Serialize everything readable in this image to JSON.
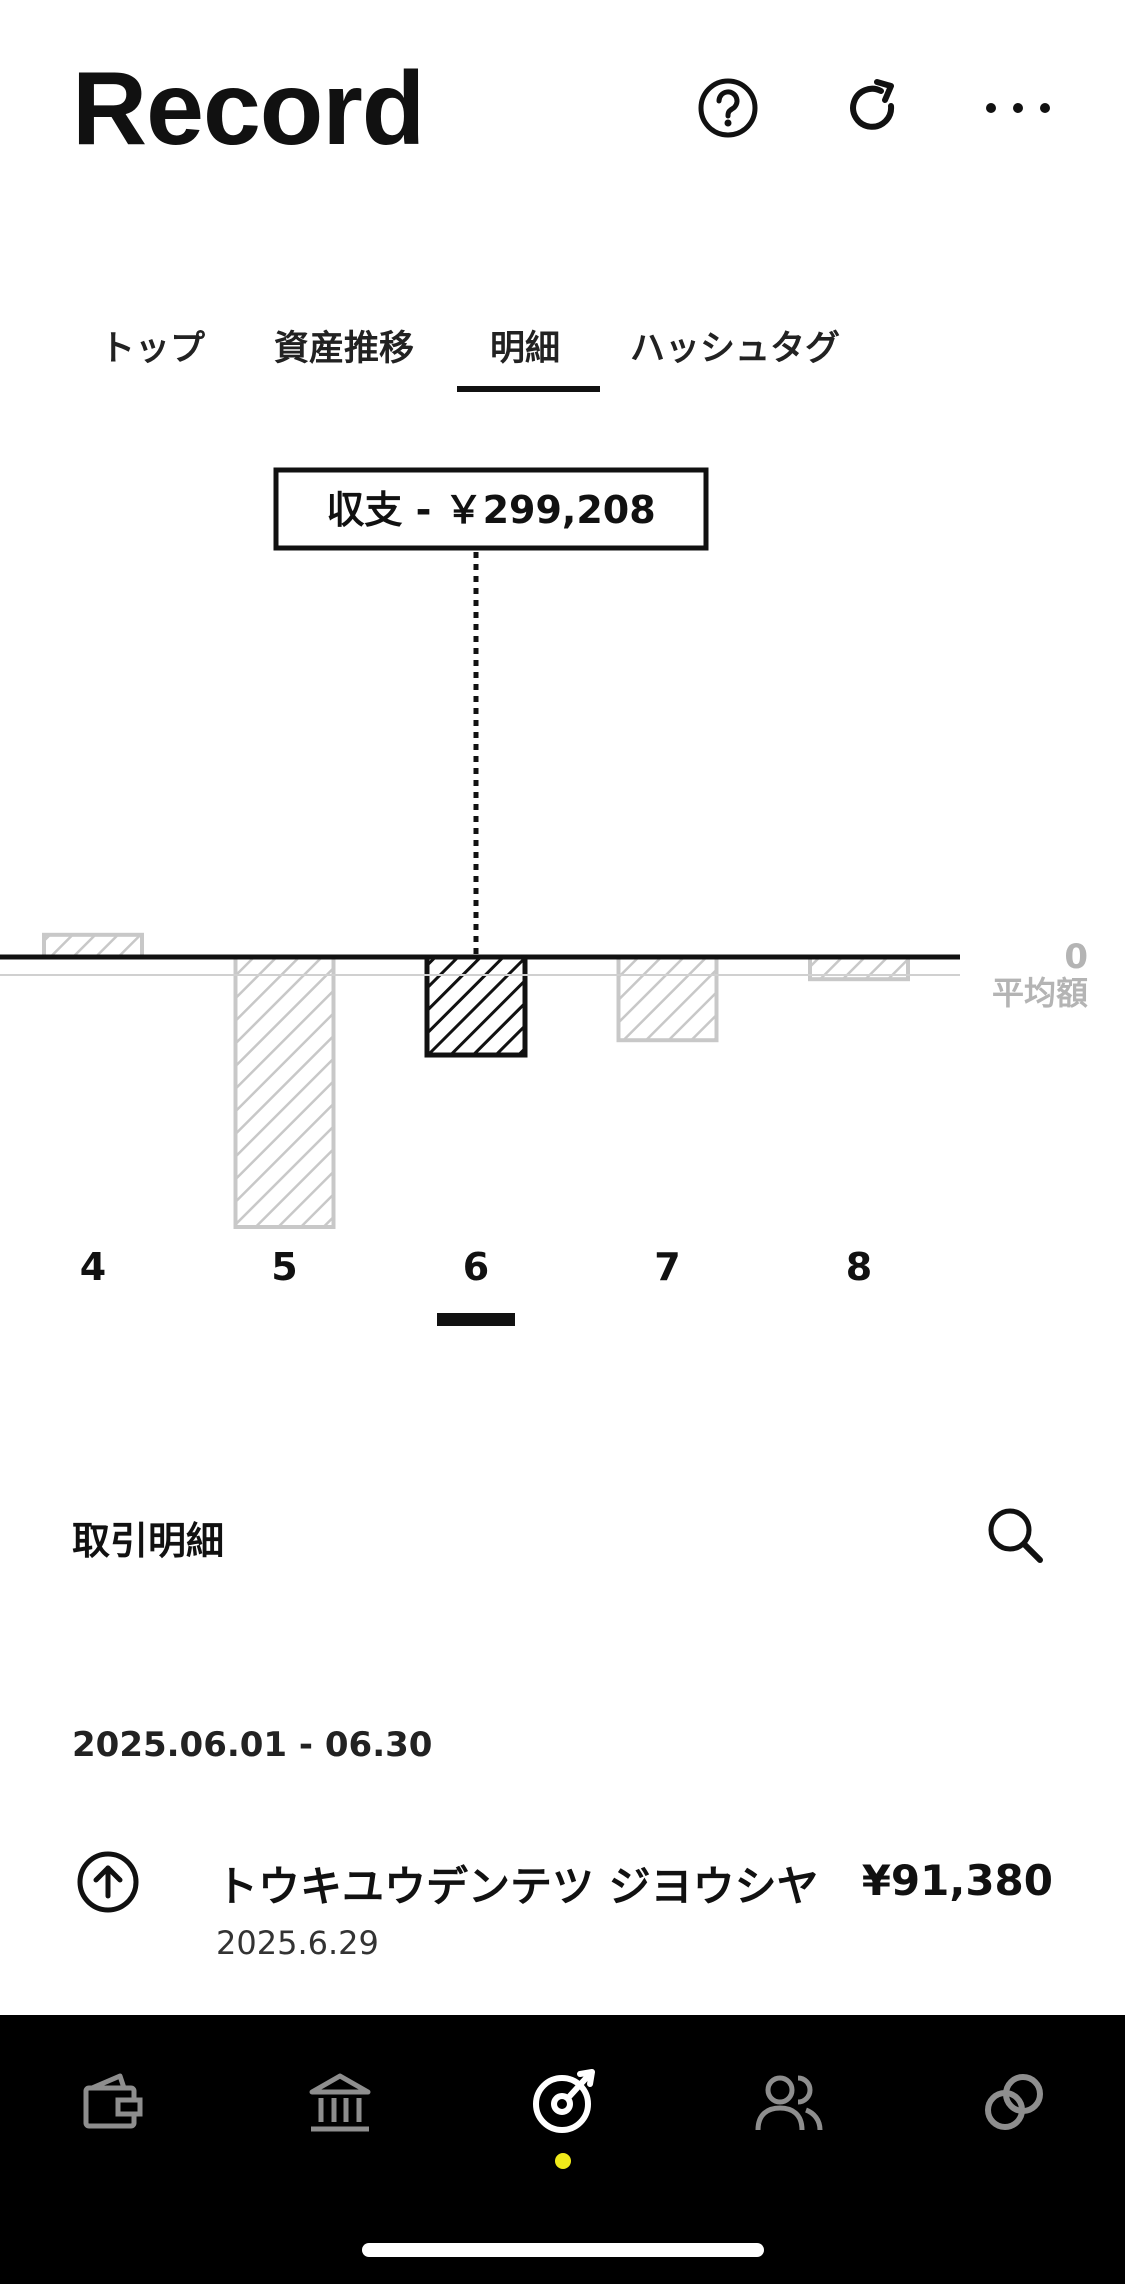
{
  "header": {
    "title": "Record",
    "icons": [
      "help-circle-icon",
      "refresh-icon",
      "more-dots-icon"
    ]
  },
  "tabs": [
    {
      "label": "トップ"
    },
    {
      "label": "資産推移"
    },
    {
      "label": "明細",
      "active": true
    },
    {
      "label": "ハッシュタグ"
    }
  ],
  "chart_data": {
    "type": "bar",
    "tooltip": "収支 - ￥299,208",
    "categories": [
      "4",
      "5",
      "6",
      "7",
      "8"
    ],
    "values": [
      12000,
      -146000,
      -53000,
      -45000,
      -12000
    ],
    "selected": "6",
    "baseline_label": "0",
    "average_label": "平均額",
    "colors": {
      "selected": "#111111",
      "muted": "#c8c8c8"
    }
  },
  "transactions": {
    "section_title": "取引明細",
    "date_range": "2025.06.01 - 06.30",
    "items": [
      {
        "name": "トウキユウデンテツ ジヨウシヤ",
        "amount": "¥91,380",
        "date": "2025.6.29",
        "icon": "arrow-up-circle-icon"
      }
    ]
  },
  "bottom_nav": {
    "items": [
      "wallet-icon",
      "bank-icon",
      "record-icon",
      "people-icon",
      "link-icon"
    ],
    "active_index": 2,
    "accent": "#f0ea1a"
  }
}
